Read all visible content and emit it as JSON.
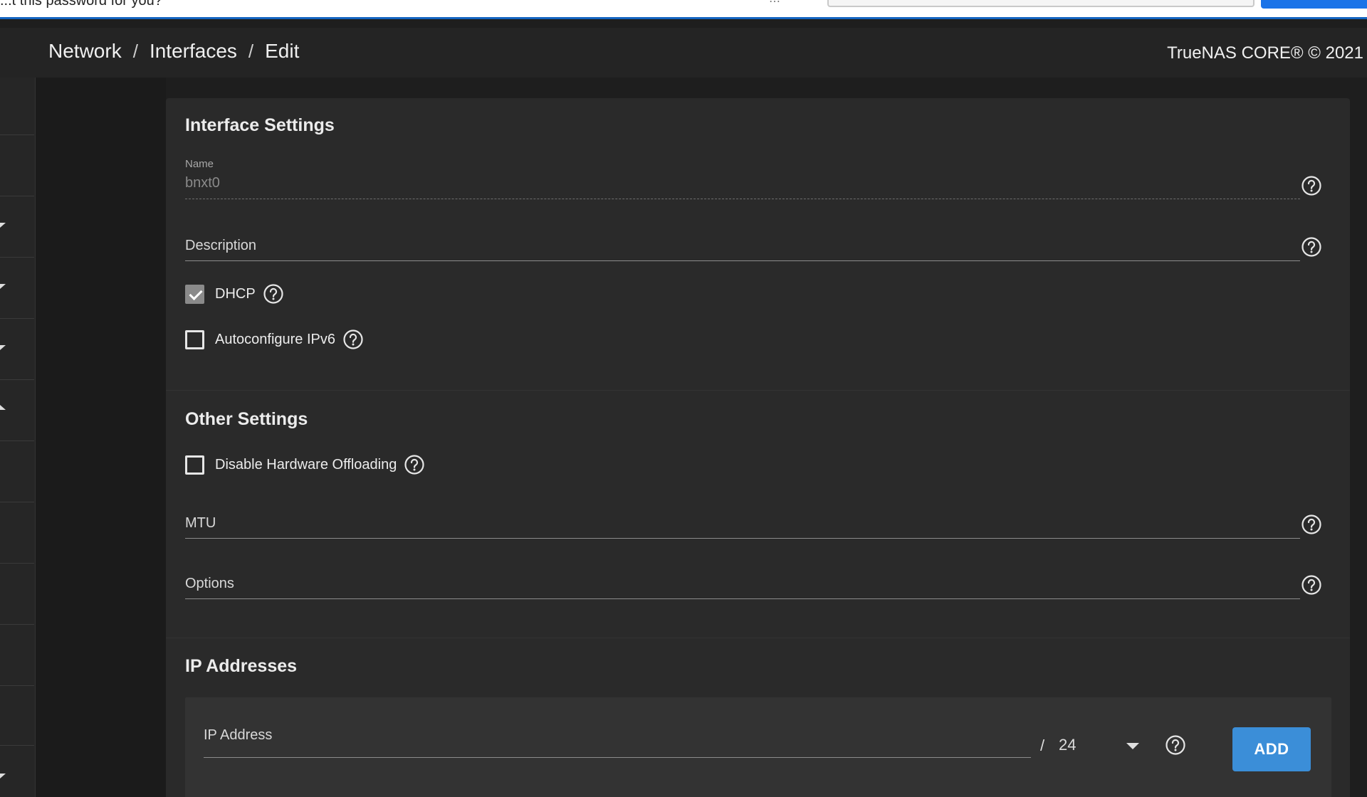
{
  "browser_bar": {
    "prompt_text": "...t this password for you?"
  },
  "breadcrumb": {
    "items": [
      "Network",
      "Interfaces",
      "Edit"
    ],
    "separator": "/"
  },
  "copyright": "TrueNAS CORE® © 2021",
  "interface_settings": {
    "title": "Interface Settings",
    "name_label": "Name",
    "name_value": "bnxt0",
    "description_placeholder": "Description",
    "dhcp": {
      "label": "DHCP",
      "checked": true
    },
    "autoconfigure_ipv6": {
      "label": "Autoconfigure IPv6",
      "checked": false
    }
  },
  "other_settings": {
    "title": "Other Settings",
    "disable_hw_offloading": {
      "label": "Disable Hardware Offloading",
      "checked": false
    },
    "mtu_placeholder": "MTU",
    "options_placeholder": "Options"
  },
  "ip_addresses": {
    "title": "IP Addresses",
    "ip_placeholder": "IP Address",
    "netmask_separator": "/",
    "netmask_value": "24",
    "add_button": "ADD"
  },
  "colors": {
    "accent": "#3b8ed8",
    "card_background": "#2a2a2a",
    "page_background": "#1e1e1e"
  },
  "icons": [
    "help-icon",
    "checkbox-checked-icon",
    "dropdown-caret-icon"
  ]
}
